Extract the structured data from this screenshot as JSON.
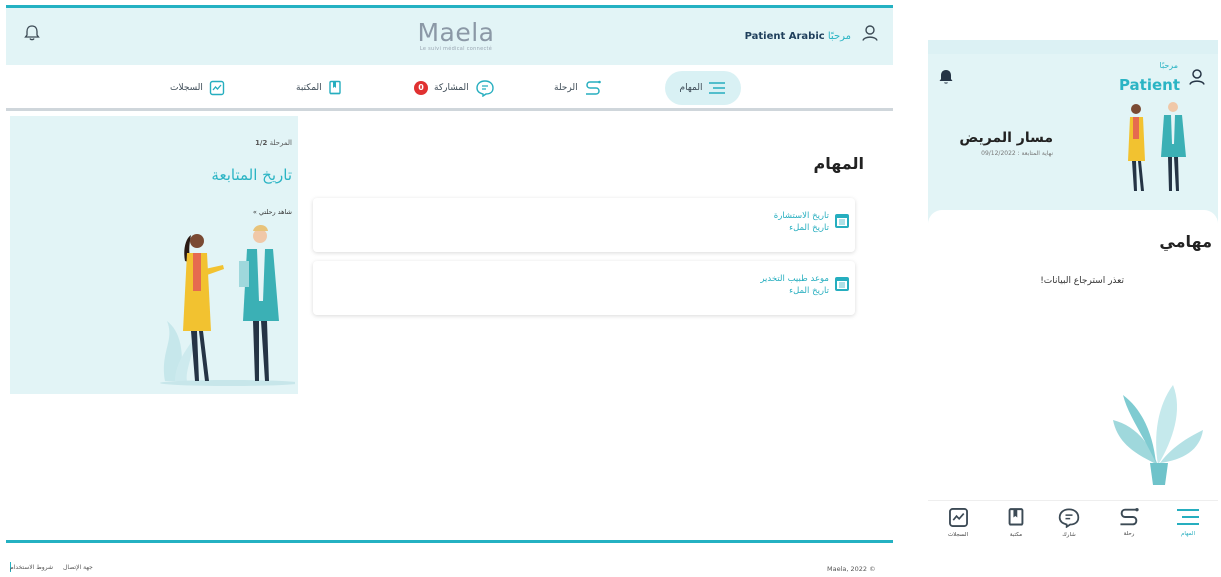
{
  "brand": {
    "logo": "Maela",
    "tagline": "Le suivi médical connecté"
  },
  "header": {
    "greeting": "مرحبًا",
    "user_name": "Patient Arabic"
  },
  "nav": {
    "tasks": "المهام",
    "journey": "الرحلة",
    "share": "المشاركة",
    "share_badge": "0",
    "library": "المكتبة",
    "records": "السجلات"
  },
  "follow_panel": {
    "phase_label": "المرحلة",
    "phase_value": "1/2",
    "title": "تاريخ المتابعة",
    "watch_label": "شاهد رحلتي »"
  },
  "main": {
    "heading": "المهام",
    "tasks": [
      {
        "title": "تاريخ الاستشارة",
        "subtitle": "تاريخ الملء"
      },
      {
        "title": "موعد طبيب التخدير",
        "subtitle": "تاريخ الملء"
      }
    ]
  },
  "footer": {
    "links": [
      "جهة الإتصال",
      "شروط الاستخدام"
    ],
    "copyright": "Maela, 2022 ©"
  },
  "mobile": {
    "greeting": "مرحبًا",
    "user_name": "Patient",
    "path_title": "مسار المريض",
    "follow_end": "نهاية المتابعة : 09/12/2022",
    "tasks_heading": "مهامي",
    "empty_message": "تعذر استرجاع البيانات!",
    "nav": {
      "tasks": "المهام",
      "journey": "رحلة",
      "share": "شارك",
      "library": "مكتبة",
      "records": "السجلات"
    }
  },
  "colors": {
    "accent": "#24b1c2",
    "header_bg": "#e2f4f6",
    "badge": "#e03131"
  }
}
